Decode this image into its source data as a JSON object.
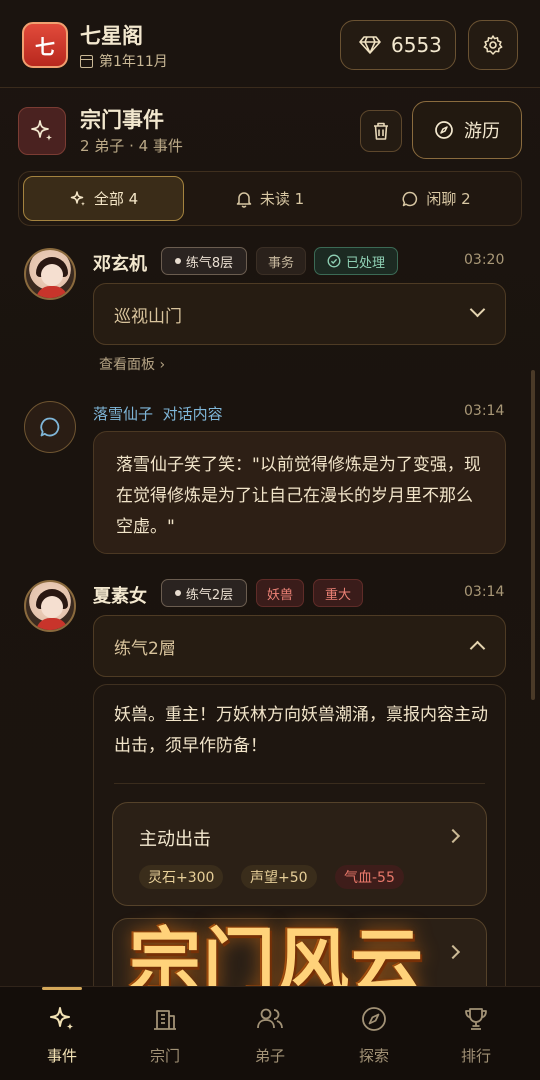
{
  "header": {
    "sect_logo_char": "七",
    "sect_name": "七星阁",
    "date": "第1年11月",
    "gems": "6553"
  },
  "section": {
    "title": "宗门事件",
    "subtitle": "2 弟子 · 4 事件",
    "travel_label": "游历"
  },
  "tabs": [
    {
      "label": "全部 4",
      "icon": "sparkle-icon",
      "active": true
    },
    {
      "label": "未读 1",
      "icon": "bell-icon",
      "active": false
    },
    {
      "label": "闲聊 2",
      "icon": "chat-bubble-icon",
      "active": false
    }
  ],
  "events": [
    {
      "name": "邓玄机",
      "realm": "练气8层",
      "tags": [
        "事务",
        "已处理"
      ],
      "time": "03:20",
      "collapsed_title": "巡视山门",
      "link": "查看面板 ›"
    },
    {
      "from": "落雪仙子",
      "type": "对话内容",
      "time": "03:14",
      "text": "落雪仙子笑了笑：\"以前觉得修炼是为了变强，现在觉得修炼是为了让自己在漫长的岁月里不那么空虚。\""
    },
    {
      "name": "夏素女",
      "realm": "练气2层",
      "tags": [
        "妖兽",
        "重大"
      ],
      "time": "03:14",
      "expanded_title": "练气2層",
      "text": "妖兽。重主！万妖林方向妖兽潮涌，禀报内容主动出击，须早作防备！",
      "choice": {
        "title": "主动出击",
        "rewards": [
          "灵石+300",
          "声望+50",
          "气血-55"
        ]
      }
    }
  ],
  "promo_title": "宗门风云",
  "nav": [
    {
      "label": "事件",
      "icon": "sparkle-icon",
      "active": true
    },
    {
      "label": "宗门",
      "icon": "building-icon",
      "active": false
    },
    {
      "label": "弟子",
      "icon": "people-icon",
      "active": false
    },
    {
      "label": "探索",
      "icon": "compass-icon",
      "active": false
    },
    {
      "label": "排行",
      "icon": "trophy-icon",
      "active": false
    }
  ],
  "colors": {
    "accent_gold": "#d4a85a",
    "danger_red": "#e8786a",
    "done_green": "#8fd0b4",
    "chat_blue": "#7fb6d8"
  }
}
